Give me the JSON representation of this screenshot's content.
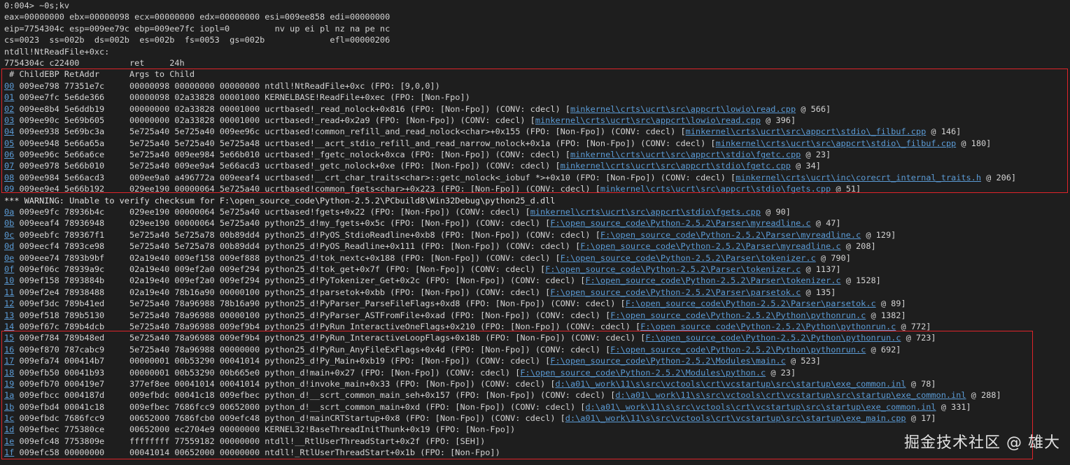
{
  "console": {
    "command_line": "0:004> ~0s;kv",
    "registers": [
      "eax=00000000 ebx=00000098 ecx=00000000 edx=00000000 esi=009ee858 edi=00000000",
      "eip=7754304c esp=009ee79c ebp=009ee7fc iopl=0         nv up ei pl nz na pe nc",
      "cs=0023  ss=002b  ds=002b  es=002b  fs=0053  gs=002b             efl=00000206"
    ],
    "symbol": "ntdll!NtReadFile+0xc:",
    "instruction": "7754304c c22400          ret     24h",
    "stack_header": " # ChildEBP RetAddr      Args to Child",
    "frames_a": [
      {
        "num": "00",
        "text": " 009ee798 77351e7c     00000098 00000000 00000000 ntdll!NtReadFile+0xc (FPO: [9,0,0])",
        "link": "",
        "suffix": ""
      },
      {
        "num": "01",
        "text": " 009ee7fc 5e6de366     00000098 02a33828 00001000 KERNELBASE!ReadFile+0xec (FPO: [Non-Fpo])",
        "link": "",
        "suffix": ""
      },
      {
        "num": "02",
        "text": " 009ee8b4 5e6ddb19     00000000 02a33828 00001000 ucrtbased!_read_nolock+0x816 (FPO: [Non-Fpo]) (CONV: cdecl) [",
        "link": "minkernel\\crts\\ucrt\\src\\appcrt\\lowio\\read.cpp",
        "suffix": " @ 566]"
      },
      {
        "num": "03",
        "text": " 009ee90c 5e69b605     00000000 02a33828 00001000 ucrtbased!_read+0x2a9 (FPO: [Non-Fpo]) (CONV: cdecl) [",
        "link": "minkernel\\crts\\ucrt\\src\\appcrt\\lowio\\read.cpp",
        "suffix": " @ 396]"
      },
      {
        "num": "04",
        "text": " 009ee938 5e69bc3a     5e725a40 5e725a40 009ee96c ucrtbased!common_refill_and_read_nolock<char>+0x155 (FPO: [Non-Fpo]) (CONV: cdecl) [",
        "link": "minkernel\\crts\\ucrt\\src\\appcrt\\stdio\\_filbuf.cpp",
        "suffix": " @ 146]"
      },
      {
        "num": "05",
        "text": " 009ee948 5e66a65a     5e725a40 5e725a40 5e725a48 ucrtbased!__acrt_stdio_refill_and_read_narrow_nolock+0x1a (FPO: [Non-Fpo]) (CONV: cdecl) [",
        "link": "minkernel\\crts\\ucrt\\src\\appcrt\\stdio\\_filbuf.cpp",
        "suffix": " @ 180]"
      },
      {
        "num": "06",
        "text": " 009ee96c 5e66a6ce     5e725a40 009ee984 5e66b010 ucrtbased!_fgetc_nolock+0xca (FPO: [Non-Fpo]) (CONV: cdecl) [",
        "link": "minkernel\\crts\\ucrt\\src\\appcrt\\stdio\\fgetc.cpp",
        "suffix": " @ 23]"
      },
      {
        "num": "07",
        "text": " 009ee978 5e66b010     5e725a40 009ee9a4 5e66acd3 ucrtbased!_getc_nolock+0xe (FPO: [Non-Fpo]) (CONV: cdecl) [",
        "link": "minkernel\\crts\\ucrt\\src\\appcrt\\stdio\\fgetc.cpp",
        "suffix": " @ 34]"
      },
      {
        "num": "08",
        "text": " 009ee984 5e66acd3     009ee9a0 a496772a 009eeaf4 ucrtbased!__crt_char_traits<char>::getc_nolock<_iobuf *>+0x10 (FPO: [Non-Fpo]) (CONV: cdecl) [",
        "link": "minkernel\\crts\\ucrt\\inc\\corecrt_internal_traits.h",
        "suffix": " @ 206]"
      },
      {
        "num": "09",
        "text": " 009ee9e4 5e66b192     029ee190 00000064 5e725a40 ucrtbased!common_fgets<char>+0x223 (FPO: [Non-Fpo]) (CONV: cdecl) [",
        "link": "minkernel\\crts\\ucrt\\src\\appcrt\\stdio\\fgets.cpp",
        "suffix": " @ 51]"
      }
    ],
    "warning": "*** WARNING: Unable to verify checksum for F:\\open_source_code\\Python-2.5.2\\PCbuild8\\Win32Debug\\python25_d.dll",
    "frames_b": [
      {
        "num": "0a",
        "text": " 009ee9fc 78936b4c     029ee190 00000064 5e725a40 ucrtbased!fgets+0x22 (FPO: [Non-Fpo]) (CONV: cdecl) [",
        "link": "minkernel\\crts\\ucrt\\src\\appcrt\\stdio\\fgets.cpp",
        "suffix": " @ 90]"
      },
      {
        "num": "0b",
        "text": " 009eeaf4 78936948     029ee190 00000064 5e725a40 python25_d!my_fgets+0x5c (FPO: [Non-Fpo]) (CONV: cdecl) [",
        "link": "F:\\open_source_code\\Python-2.5.2\\Parser\\myreadline.c",
        "suffix": " @ 47]"
      },
      {
        "num": "0c",
        "text": " 009eebfc 789367f1     5e725a40 5e725a78 00b89dd4 python25_d!PyOS_StdioReadline+0xb8 (FPO: [Non-Fpo]) (CONV: cdecl) [",
        "link": "F:\\open_source_code\\Python-2.5.2\\Parser\\myreadline.c",
        "suffix": " @ 129]"
      },
      {
        "num": "0d",
        "text": " 009eecf4 7893ce98     5e725a40 5e725a78 00b89dd4 python25_d!PyOS_Readline+0x111 (FPO: [Non-Fpo]) (CONV: cdecl) [",
        "link": "F:\\open_source_code\\Python-2.5.2\\Parser\\myreadline.c",
        "suffix": " @ 208]"
      },
      {
        "num": "0e",
        "text": " 009eee74 7893b9bf     02a19e40 009ef158 009ef888 python25_d!tok_nextc+0x188 (FPO: [Non-Fpo]) (CONV: cdecl) [",
        "link": "F:\\open_source_code\\Python-2.5.2\\Parser\\tokenizer.c",
        "suffix": " @ 790]"
      },
      {
        "num": "0f",
        "text": " 009ef06c 78939a9c     02a19e40 009ef2a0 009ef294 python25_d!tok_get+0x7f (FPO: [Non-Fpo]) (CONV: cdecl) [",
        "link": "F:\\open_source_code\\Python-2.5.2\\Parser\\tokenizer.c",
        "suffix": " @ 1137]"
      },
      {
        "num": "10",
        "text": " 009ef158 7893884b     02a19e40 009ef2a0 009ef294 python25_d!PyTokenizer_Get+0x2c (FPO: [Non-Fpo]) (CONV: cdecl) [",
        "link": "F:\\open_source_code\\Python-2.5.2\\Parser\\tokenizer.c",
        "suffix": " @ 1528]"
      },
      {
        "num": "11",
        "text": " 009ef2e4 78938488     02a19e40 78b16a90 00000100 python25_d!parsetok+0xbb (FPO: [Non-Fpo]) (CONV: cdecl) [",
        "link": "F:\\open_source_code\\Python-2.5.2\\Parser\\parsetok.c",
        "suffix": " @ 135]"
      },
      {
        "num": "12",
        "text": " 009ef3dc 789b41ed     5e725a40 78a96988 78b16a90 python25_d!PyParser_ParseFileFlags+0xd8 (FPO: [Non-Fpo]) (CONV: cdecl) [",
        "link": "F:\\open_source_code\\Python-2.5.2\\Parser\\parsetok.c",
        "suffix": " @ 89]"
      },
      {
        "num": "13",
        "text": " 009ef518 789b5130     5e725a40 78a96988 00000100 python25_d!PyParser_ASTFromFile+0xad (FPO: [Non-Fpo]) (CONV: cdecl) [",
        "link": "F:\\open_source_code\\Python-2.5.2\\Python\\pythonrun.c",
        "suffix": " @ 1382]"
      },
      {
        "num": "14",
        "text": " 009ef67c 789b4dcb     5e725a40 78a96988 009ef9b4 python25_d!PyRun_InteractiveOneFlags+0x210 (FPO: [Non-Fpo]) (CONV: cdecl) [",
        "link": "F:\\open_source_code\\Python-2.5.2\\Python\\pythonrun.c",
        "suffix": " @ 772]"
      }
    ],
    "frames_c": [
      {
        "num": "15",
        "text": " 009ef784 789b48ed     5e725a40 78a96988 009ef9b4 python25_d!PyRun_InteractiveLoopFlags+0x18b (FPO: [Non-Fpo]) (CONV: cdecl) [",
        "link": "F:\\open_source_code\\Python-2.5.2\\Python\\pythonrun.c",
        "suffix": " @ 723]"
      },
      {
        "num": "16",
        "text": " 009ef870 787cabc9     5e725a40 78a96988 00000000 python25_d!PyRun_AnyFileExFlags+0x4d (FPO: [Non-Fpo]) (CONV: cdecl) [",
        "link": "F:\\open_source_code\\Python-2.5.2\\Python\\pythonrun.c",
        "suffix": " @ 692]"
      },
      {
        "num": "17",
        "text": " 009efa74 000414b7     00000001 00b53290 00041014 python25_d!Py_Main+0xb19 (FPO: [Non-Fpo]) (CONV: cdecl) [",
        "link": "F:\\open_source_code\\Python-2.5.2\\Modules\\main.c",
        "suffix": " @ 523]"
      },
      {
        "num": "18",
        "text": " 009efb50 00041b93     00000001 00b53290 00b665e0 python_d!main+0x27 (FPO: [Non-Fpo]) (CONV: cdecl) [",
        "link": "F:\\open_source_code\\Python-2.5.2\\Modules\\python.c",
        "suffix": " @ 23]"
      },
      {
        "num": "19",
        "text": " 009efb70 000419e7     377ef8ee 00041014 00041014 python_d!invoke_main+0x33 (FPO: [Non-Fpo]) (CONV: cdecl) [",
        "link": "d:\\a01\\_work\\11\\s\\src\\vctools\\crt\\vcstartup\\src\\startup\\exe_common.inl",
        "suffix": " @ 78]"
      },
      {
        "num": "1a",
        "text": " 009efbcc 0004187d     009efbdc 00041c18 009efbec python_d!__scrt_common_main_seh+0x157 (FPO: [Non-Fpo]) (CONV: cdecl) [",
        "link": "d:\\a01\\_work\\11\\s\\src\\vctools\\crt\\vcstartup\\src\\startup\\exe_common.inl",
        "suffix": " @ 288]"
      },
      {
        "num": "1b",
        "text": " 009efbd4 00041c18     009efbec 7686fcc9 00652000 python_d!__scrt_common_main+0xd (FPO: [Non-Fpo]) (CONV: cdecl) [",
        "link": "d:\\a01\\_work\\11\\s\\src\\vctools\\crt\\vcstartup\\src\\startup\\exe_common.inl",
        "suffix": " @ 331]"
      },
      {
        "num": "1c",
        "text": " 009efbdc 7686fcc9     00652000 7686fcb0 009efc48 python_d!mainCRTStartup+0x8 (FPO: [Non-Fpo]) (CONV: cdecl) [",
        "link": "d:\\a01\\_work\\11\\s\\src\\vctools\\crt\\vcstartup\\src\\startup\\exe_main.cpp",
        "suffix": " @ 17]"
      },
      {
        "num": "1d",
        "text": " 009efbec 775380ce     00652000 ec2704e9 00000000 KERNEL32!BaseThreadInitThunk+0x19 (FPO: [Non-Fpo])",
        "link": "",
        "suffix": ""
      },
      {
        "num": "1e",
        "text": " 009efc48 7753809e     ffffffff 77559182 00000000 ntdll!__RtlUserThreadStart+0x2f (FPO: [SEH])",
        "link": "",
        "suffix": ""
      },
      {
        "num": "1f",
        "text": " 009efc58 00000000     00041014 00652000 00000000 ntdll!_RtlUserThreadStart+0x1b (FPO: [Non-Fpo])",
        "link": "",
        "suffix": ""
      }
    ]
  },
  "watermark": "掘金技术社区 @ 雄大",
  "colors": {
    "background": "#1e1e1e",
    "text": "#d4d4d4",
    "link": "#5b9bd5",
    "highlight_box": "#e0242a"
  }
}
